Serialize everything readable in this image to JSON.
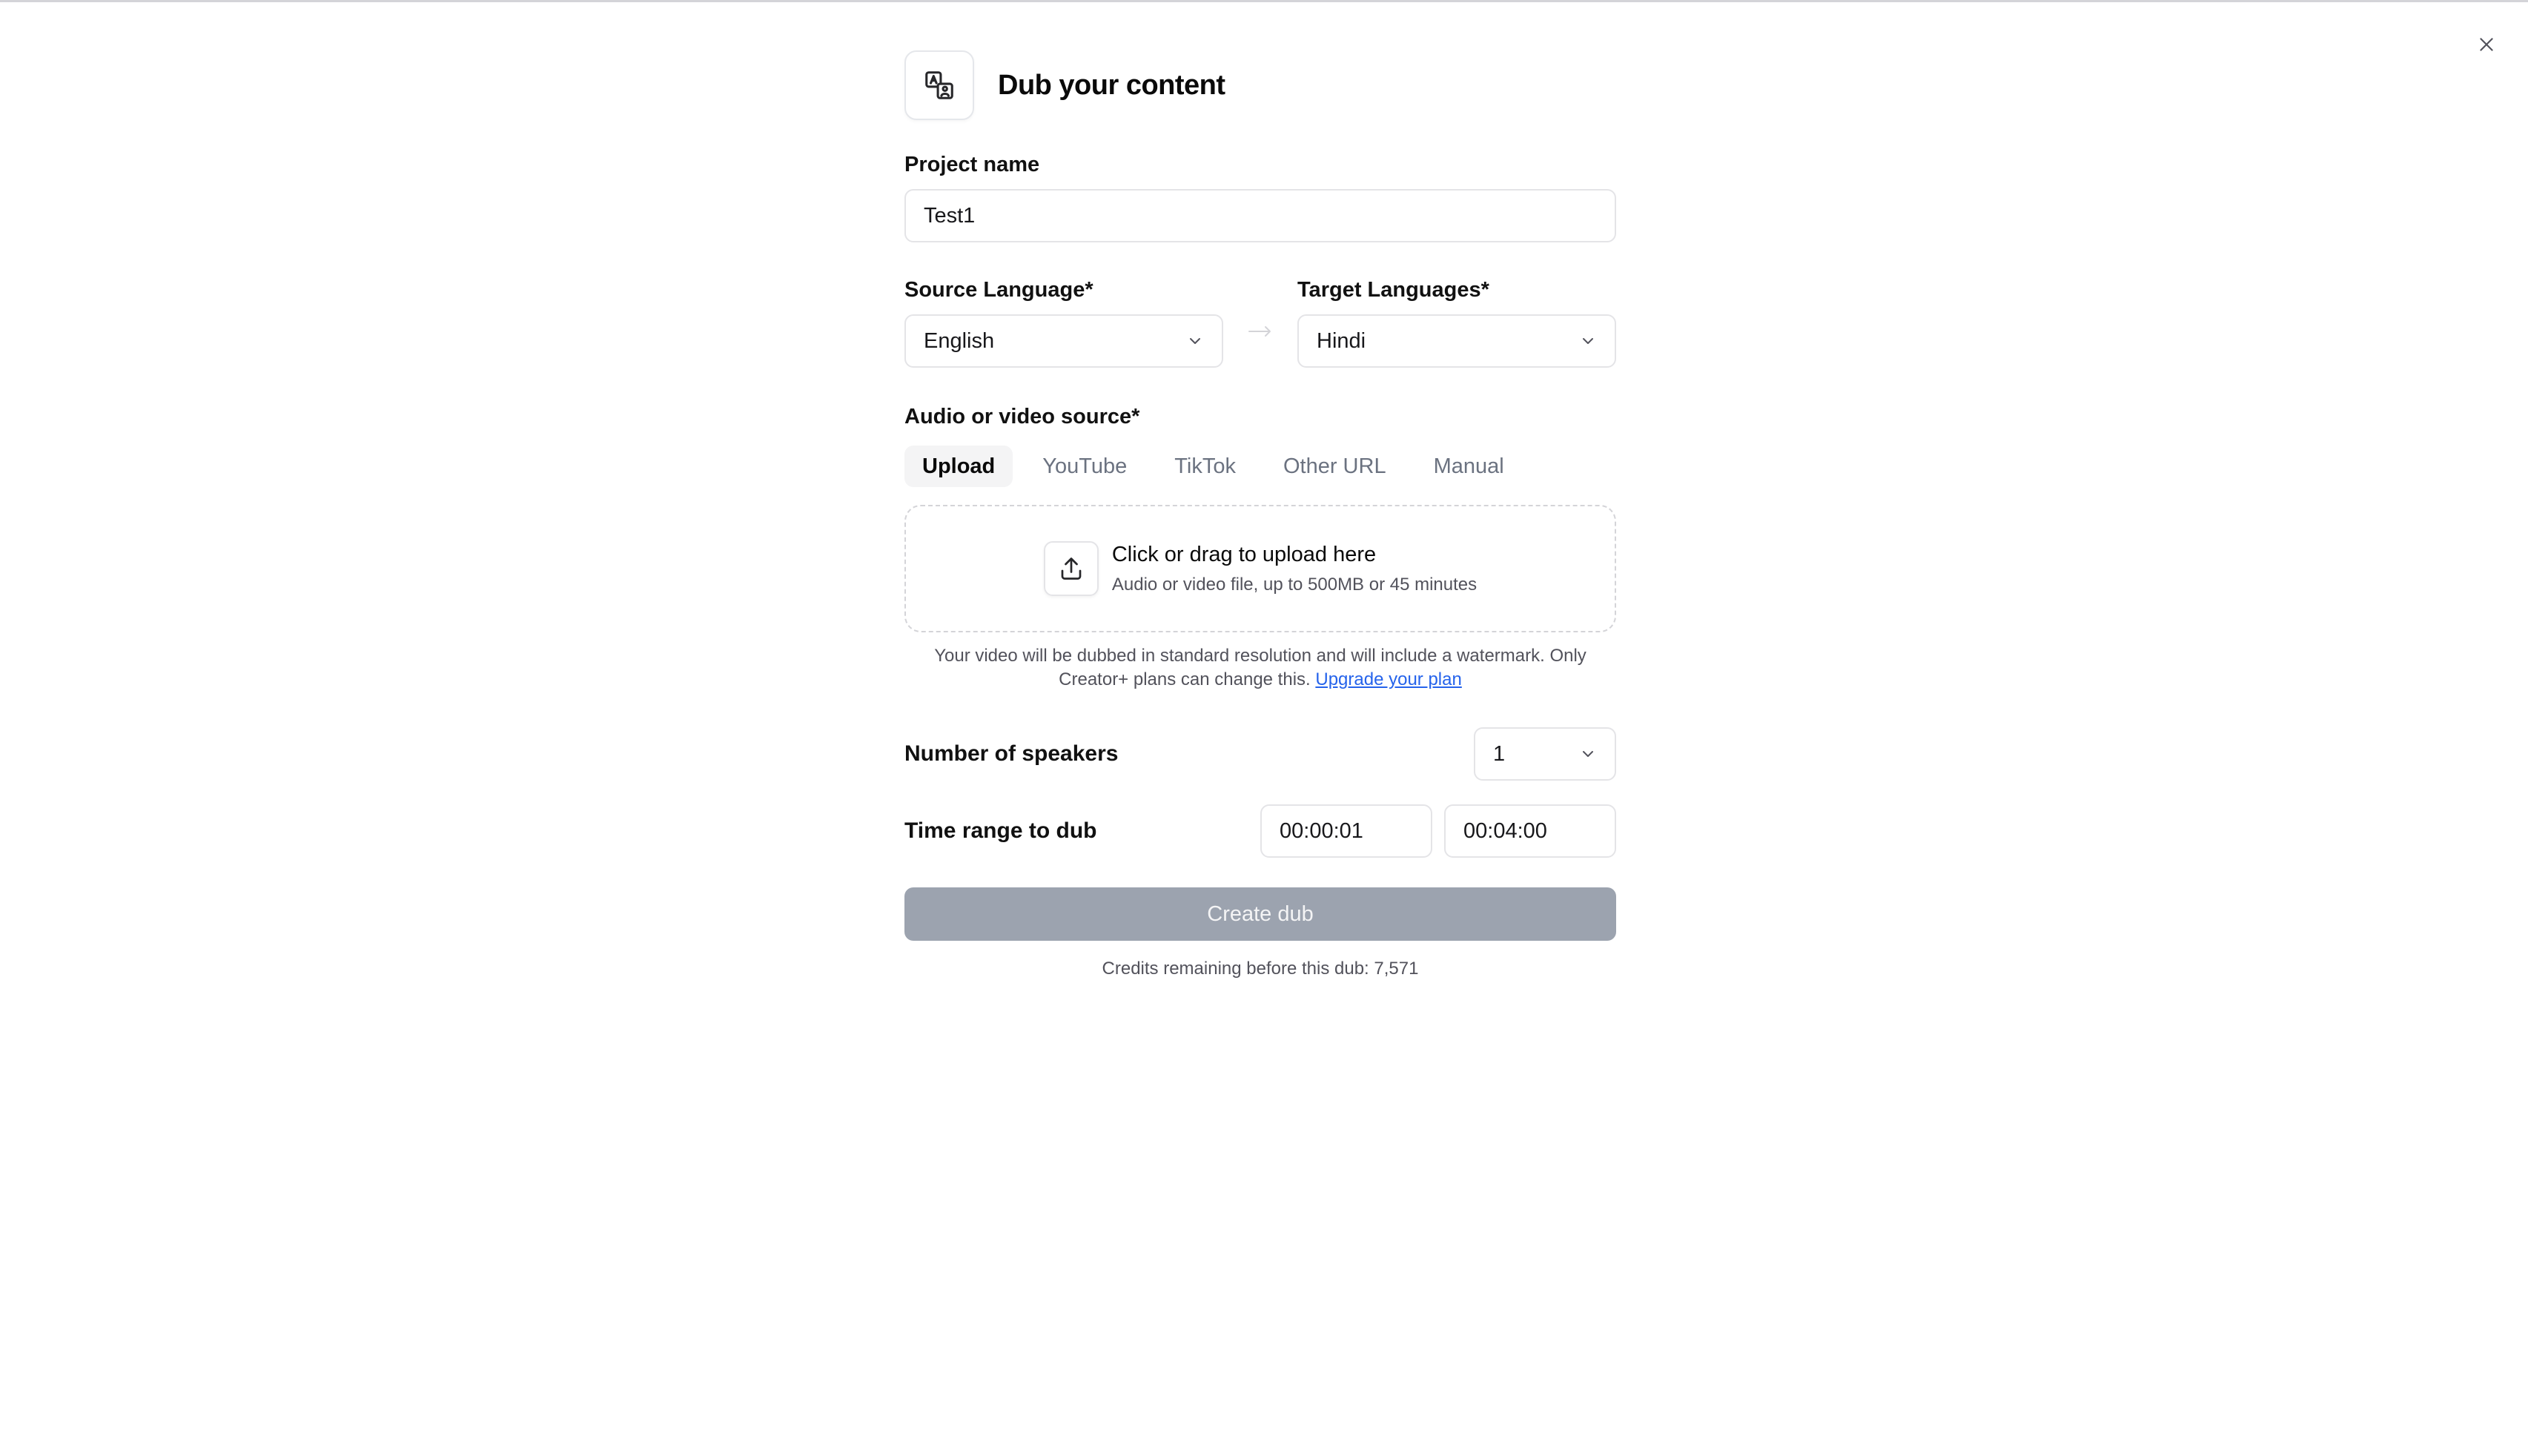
{
  "dialog": {
    "title": "Dub your content",
    "header_icon": "translate-icon",
    "close_icon": "close-icon"
  },
  "project": {
    "label": "Project name",
    "value": "Test1"
  },
  "languages": {
    "source_label": "Source Language*",
    "source_value": "English",
    "target_label": "Target Languages*",
    "target_value": "Hindi",
    "arrow_icon": "arrow-right-icon"
  },
  "source": {
    "label": "Audio or video source*",
    "tabs": [
      {
        "label": "Upload",
        "active": true
      },
      {
        "label": "YouTube",
        "active": false
      },
      {
        "label": "TikTok",
        "active": false
      },
      {
        "label": "Other URL",
        "active": false
      },
      {
        "label": "Manual",
        "active": false
      }
    ],
    "dropzone_title": "Click or drag to upload here",
    "dropzone_subtitle": "Audio or video file, up to 500MB or 45 minutes",
    "upload_icon": "upload-icon"
  },
  "notice": {
    "line1": "Your video will be dubbed in standard resolution and will include a watermark. Only",
    "line2": "Creator+ plans can change this.",
    "link": "Upgrade your plan",
    "link_color": "#2563eb"
  },
  "speakers": {
    "label": "Number of speakers",
    "value": "1"
  },
  "time_range": {
    "label": "Time range to dub",
    "start": "00:00:01",
    "end": "00:04:00"
  },
  "create_button": {
    "label": "Create dub",
    "disabled": true,
    "color": "#9ca3af"
  },
  "credits": {
    "text": "Credits remaining before this dub: 7,571"
  }
}
